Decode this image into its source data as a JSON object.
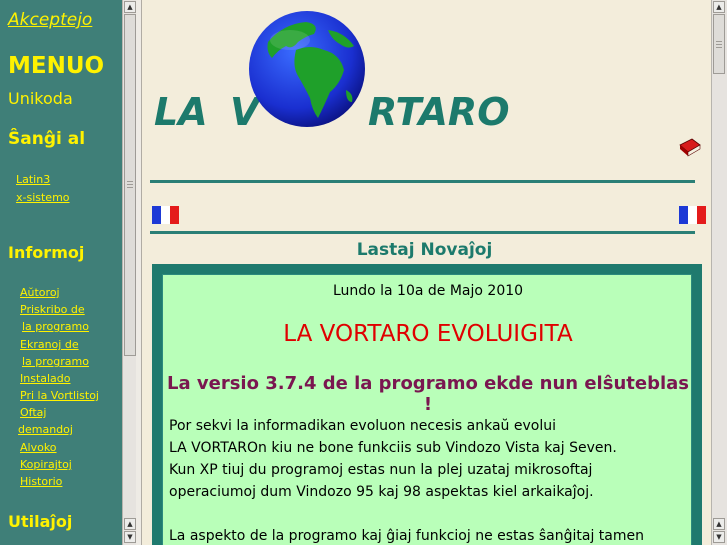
{
  "sidebar": {
    "accept_link": "Akceptejo",
    "menu_title": "MENUO",
    "encoding": "Unikoda",
    "change_to": "Ŝanĝi al",
    "encoding_options": [
      "Latin3",
      "x-sistemo"
    ],
    "info_header": "Informoj",
    "info_links": [
      "Aŭtoroj",
      "Priskribo de",
      "la programo",
      "Ekranoj de",
      "la programo",
      "Instalado",
      "Pri la Vortlistoj",
      "Oftaj",
      "demandoj",
      "Alvoko",
      "Kopirajtoj",
      "Historio"
    ],
    "tools_header": "Utilaĵoj"
  },
  "header": {
    "title_la": "LA",
    "title_v": "V",
    "title_rtaro": "RTARO"
  },
  "news": {
    "section_title": "Lastaj Novaĵoj",
    "date": "Lundo la 10a de Majo 2010",
    "headline": "LA VORTARO EVOLUIGITA",
    "subhead": "La versio 3.7.4 de la programo ekde nun elŝuteblas !",
    "paragraph_lines": [
      "Por sekvi la informadikan evoluon necesis ankaŭ evolui",
      "LA VORTAROn kiu ne bone funkciis sub Vindozo Vista kaj Seven.",
      "Kun XP tiuj du programoj estas nun la plej uzataj mikrosoftaj",
      "operaciumoj dum Vindozo 95 kaj 98 aspektas kiel arkaikaĵoj.",
      "La aspekto de la programo kaj ĝiaj funkcioj ne estas ŝanĝitaj tamen"
    ]
  },
  "colors": {
    "sidebar_bg": "#3f7f78",
    "sidebar_text": "#fff200",
    "page_bg": "#f3eddb",
    "accent": "#1c7a6c",
    "news_bg": "#b9ffb9",
    "headline": "#e00000",
    "subhead": "#7a1650"
  },
  "icons": {
    "globe": "globe-icon",
    "book": "book-icon",
    "flag": "french-flag-icon"
  }
}
